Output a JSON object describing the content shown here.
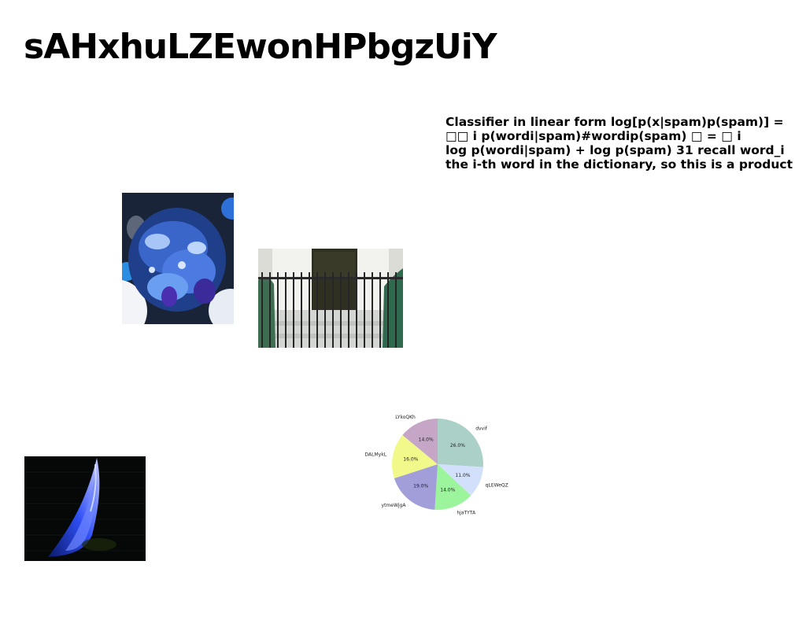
{
  "page": {
    "title": "sAHxhuLZEwonHPbgzUiY",
    "text_lines": [
      "Classifier in linear form log[p(x|spam)p(spam)] =",
      "□□ i p(wordi|spam)#wordip(spam) □ = □ i",
      "log p(wordi|spam) + log p(spam) 31 recall word_i",
      "the i-th word in the dictionary, so this is a product"
    ]
  },
  "images": {
    "food": "blue-tinted-food-photo",
    "door": "gated-doorway-photo",
    "flame": "blue-flame-photo"
  },
  "chart_data": {
    "type": "pie",
    "title": "",
    "labels": [
      "dvvif",
      "qLEWeQZ",
      "hjaTYTA",
      "ytmeWjgA",
      "DALMykL",
      "LYkoQKh"
    ],
    "values": [
      26.0,
      11.0,
      14.0,
      19.0,
      16.0,
      14.0
    ],
    "value_labels": [
      "26.0%",
      "11.0%",
      "14.0%",
      "19.0%",
      "16.0%",
      "14.0%"
    ],
    "colors": [
      "#abd0c8",
      "#d3e0fc",
      "#9cf49d",
      "#a19ed9",
      "#f0f98a",
      "#c5a6c7"
    ],
    "start_angle": "top",
    "direction": "clockwise"
  }
}
